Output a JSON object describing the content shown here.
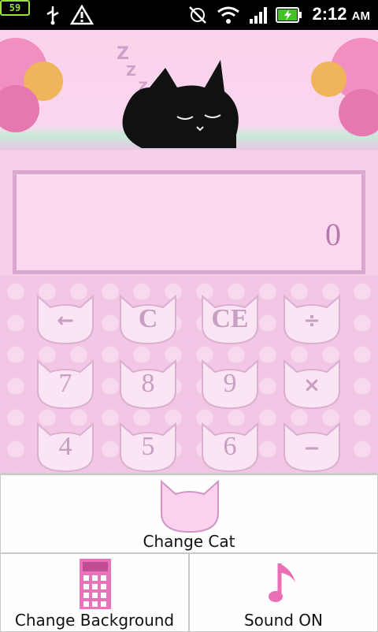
{
  "status_bar": {
    "battery_level_left": "59",
    "time": "2:12",
    "ampm": "AM",
    "icons": [
      "battery-icon",
      "usb-icon",
      "warning-icon",
      "gps-icon",
      "wifi-icon",
      "signal-icon",
      "battery-charging-icon"
    ]
  },
  "display": {
    "value": "0"
  },
  "keys": [
    {
      "label": "←"
    },
    {
      "label": "C"
    },
    {
      "label": "CE"
    },
    {
      "label": "÷"
    },
    {
      "label": "7"
    },
    {
      "label": "8"
    },
    {
      "label": "9"
    },
    {
      "label": "×"
    },
    {
      "label": "4"
    },
    {
      "label": "5"
    },
    {
      "label": "6"
    },
    {
      "label": "−"
    }
  ],
  "menu": {
    "change_cat": "Change Cat",
    "change_background": "Change Background",
    "sound": "Sound ON"
  },
  "colors": {
    "pink_bg": "#f6cfe9",
    "accent": "#c79fc1",
    "menu_bg": "#fdf6fb"
  }
}
